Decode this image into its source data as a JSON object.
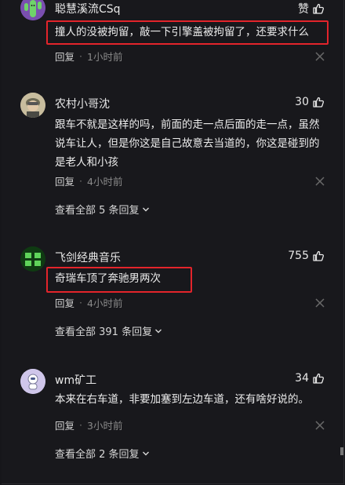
{
  "comments": [
    {
      "username": "聪慧溪流CSq",
      "likes": "赞",
      "text": "撞人的没被拘留，敲一下引擎盖被拘留了，还要求什么",
      "reply_label": "回复",
      "time": "1小时前"
    },
    {
      "username": "农村小哥沈",
      "likes": "30",
      "text": "跟车不就是这样的吗，前面的走一点后面的走一点，虽然说车让人，但是你这是自己故意去当道的，你这是碰到的是老人和小孩",
      "reply_label": "回复",
      "time": "4小时前",
      "view_all": "查看全部 5 条回复"
    },
    {
      "username": "飞剑经典音乐",
      "avatar_text": "经典\n音乐",
      "likes": "755",
      "text": "奇瑞车顶了奔驰男两次",
      "reply_label": "回复",
      "time": "4小时前",
      "view_all": "查看全部 391 条回复"
    },
    {
      "username": "wm矿工",
      "likes": "34",
      "text": "本来在右车道，非要加塞到左边车道，还有啥好说的。",
      "reply_label": "回复",
      "time": "3小时前",
      "view_all": "查看全部 2 条回复"
    }
  ],
  "colors": {
    "background": "#18181c",
    "highlight": "#e3242b",
    "text": "#ececec",
    "muted": "#8a8a8a"
  },
  "icons": [
    "thumb-up-icon",
    "close-icon",
    "chevron-down-icon"
  ]
}
